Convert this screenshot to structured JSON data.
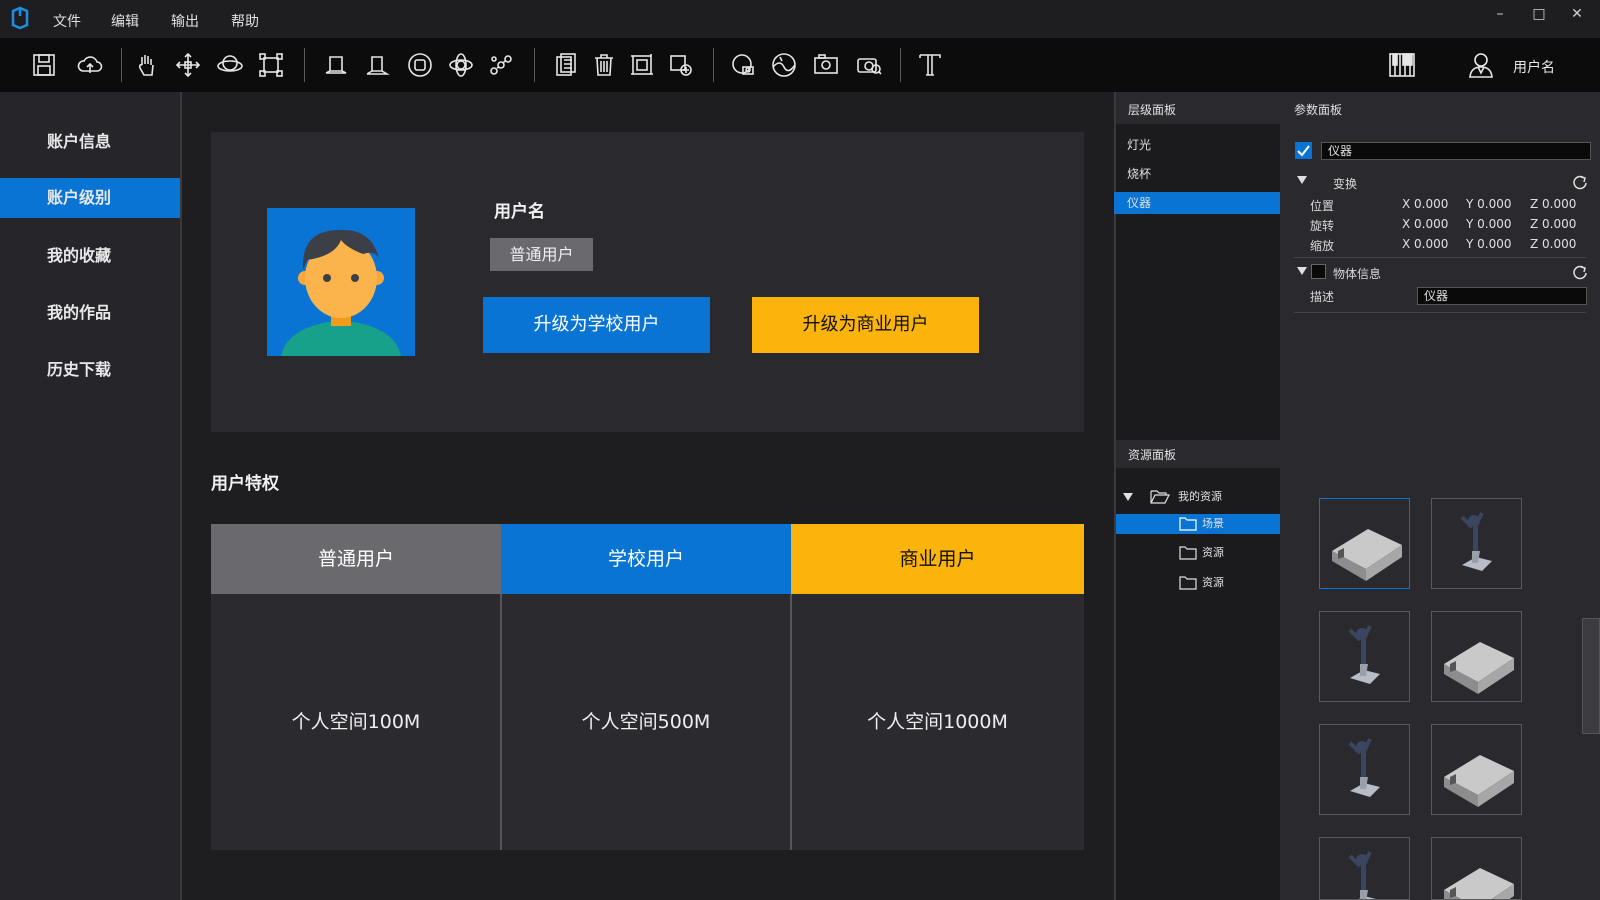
{
  "menu": {
    "file": "文件",
    "edit": "编辑",
    "output": "输出",
    "help": "帮助"
  },
  "window_controls": {
    "minimize": "–",
    "maximize": "□",
    "close": "✕"
  },
  "toolbar": {
    "icons": [
      "save-icon",
      "cloud-upload-icon",
      "hand-icon",
      "move-icon",
      "orbit-icon",
      "scale-icon",
      "box-icon",
      "plane-icon",
      "circle-icon",
      "rotate-icon",
      "transform-icon",
      "paste-icon",
      "delete-icon",
      "frame-icon",
      "position-icon",
      "camera-icon",
      "sphere-icon",
      "screenshot-icon",
      "render-icon",
      "text-icon",
      "keyboard-icon",
      "user-icon"
    ],
    "user_label": "用户名"
  },
  "sidebar": {
    "items": [
      {
        "label": "账户信息",
        "active": false
      },
      {
        "label": "账户级别",
        "active": true
      },
      {
        "label": "我的收藏",
        "active": false
      },
      {
        "label": "我的作品",
        "active": false
      },
      {
        "label": "历史下载",
        "active": false
      }
    ]
  },
  "profile": {
    "username": "用户名",
    "role": "普通用户",
    "upgrade_school": "升级为学校用户",
    "upgrade_business": "升级为商业用户"
  },
  "privileges": {
    "title": "用户特权",
    "plans": [
      {
        "name": "普通用户",
        "storage": "个人空间100M",
        "color": "#6a6a6e"
      },
      {
        "name": "学校用户",
        "storage": "个人空间500M",
        "color": "#0a74d4"
      },
      {
        "name": "商业用户",
        "storage": "个人空间1000M",
        "color": "#fbb40b"
      }
    ]
  },
  "hierarchy": {
    "title": "层级面板",
    "items": [
      {
        "label": "灯光",
        "active": false
      },
      {
        "label": "烧杯",
        "active": false
      },
      {
        "label": "仪器",
        "active": true
      }
    ]
  },
  "params": {
    "title": "参数面板",
    "object_name": "仪器",
    "transform_label": "变换",
    "rows": [
      {
        "label": "位置",
        "x": "X 0.000",
        "y": "Y 0.000",
        "z": "Z 0.000"
      },
      {
        "label": "旋转",
        "x": "X 0.000",
        "y": "Y 0.000",
        "z": "Z 0.000"
      },
      {
        "label": "缩放",
        "x": "X 0.000",
        "y": "Y 0.000",
        "z": "Z 0.000"
      }
    ],
    "object_info_label": "物体信息",
    "desc_label": "描述",
    "desc_value": "仪器"
  },
  "resources": {
    "title": "资源面板",
    "root": "我的资源",
    "children": [
      {
        "label": "场景",
        "active": true
      },
      {
        "label": "资源",
        "active": false
      },
      {
        "label": "资源",
        "active": false
      }
    ],
    "thumbnails": [
      "box",
      "stand",
      "stand",
      "box",
      "stand",
      "box",
      "stand",
      "box"
    ]
  },
  "colors": {
    "accent": "#0a74d4",
    "yellow": "#fbb40b",
    "gray": "#6a6a6e"
  }
}
